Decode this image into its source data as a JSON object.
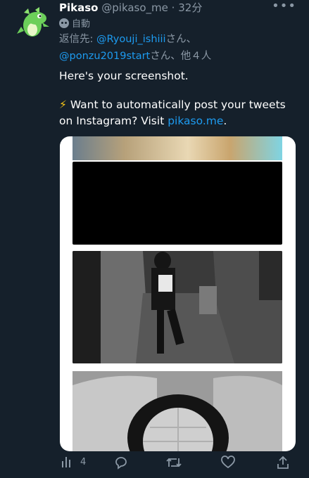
{
  "tweet": {
    "name": "Pikaso",
    "handle": "@pikaso_me",
    "dot": "·",
    "time": "32分",
    "more": "•••",
    "automated_label": "自動",
    "reply_prefix": "返信先: ",
    "reply_user1": "@Ryouji_ishiii",
    "reply_mid": "さん、",
    "reply_user2": "@ponzu2019start",
    "reply_suffix": "さん、他４人",
    "line1": "Here's your screenshot.",
    "line2_emoji": "⚡",
    "line2_text": " Want to automatically post your tweets on Instagram? Visit ",
    "line2_link": "pikaso.me",
    "line2_end": "."
  },
  "actions": {
    "views_count": "4"
  },
  "colors": {
    "background": "#15202b",
    "link": "#1d9bf0",
    "muted": "#8b98a5"
  },
  "icons": [
    "dragon-avatar",
    "more-icon",
    "bot-icon",
    "views-icon",
    "reply-icon",
    "retweet-icon",
    "like-icon",
    "share-icon"
  ]
}
